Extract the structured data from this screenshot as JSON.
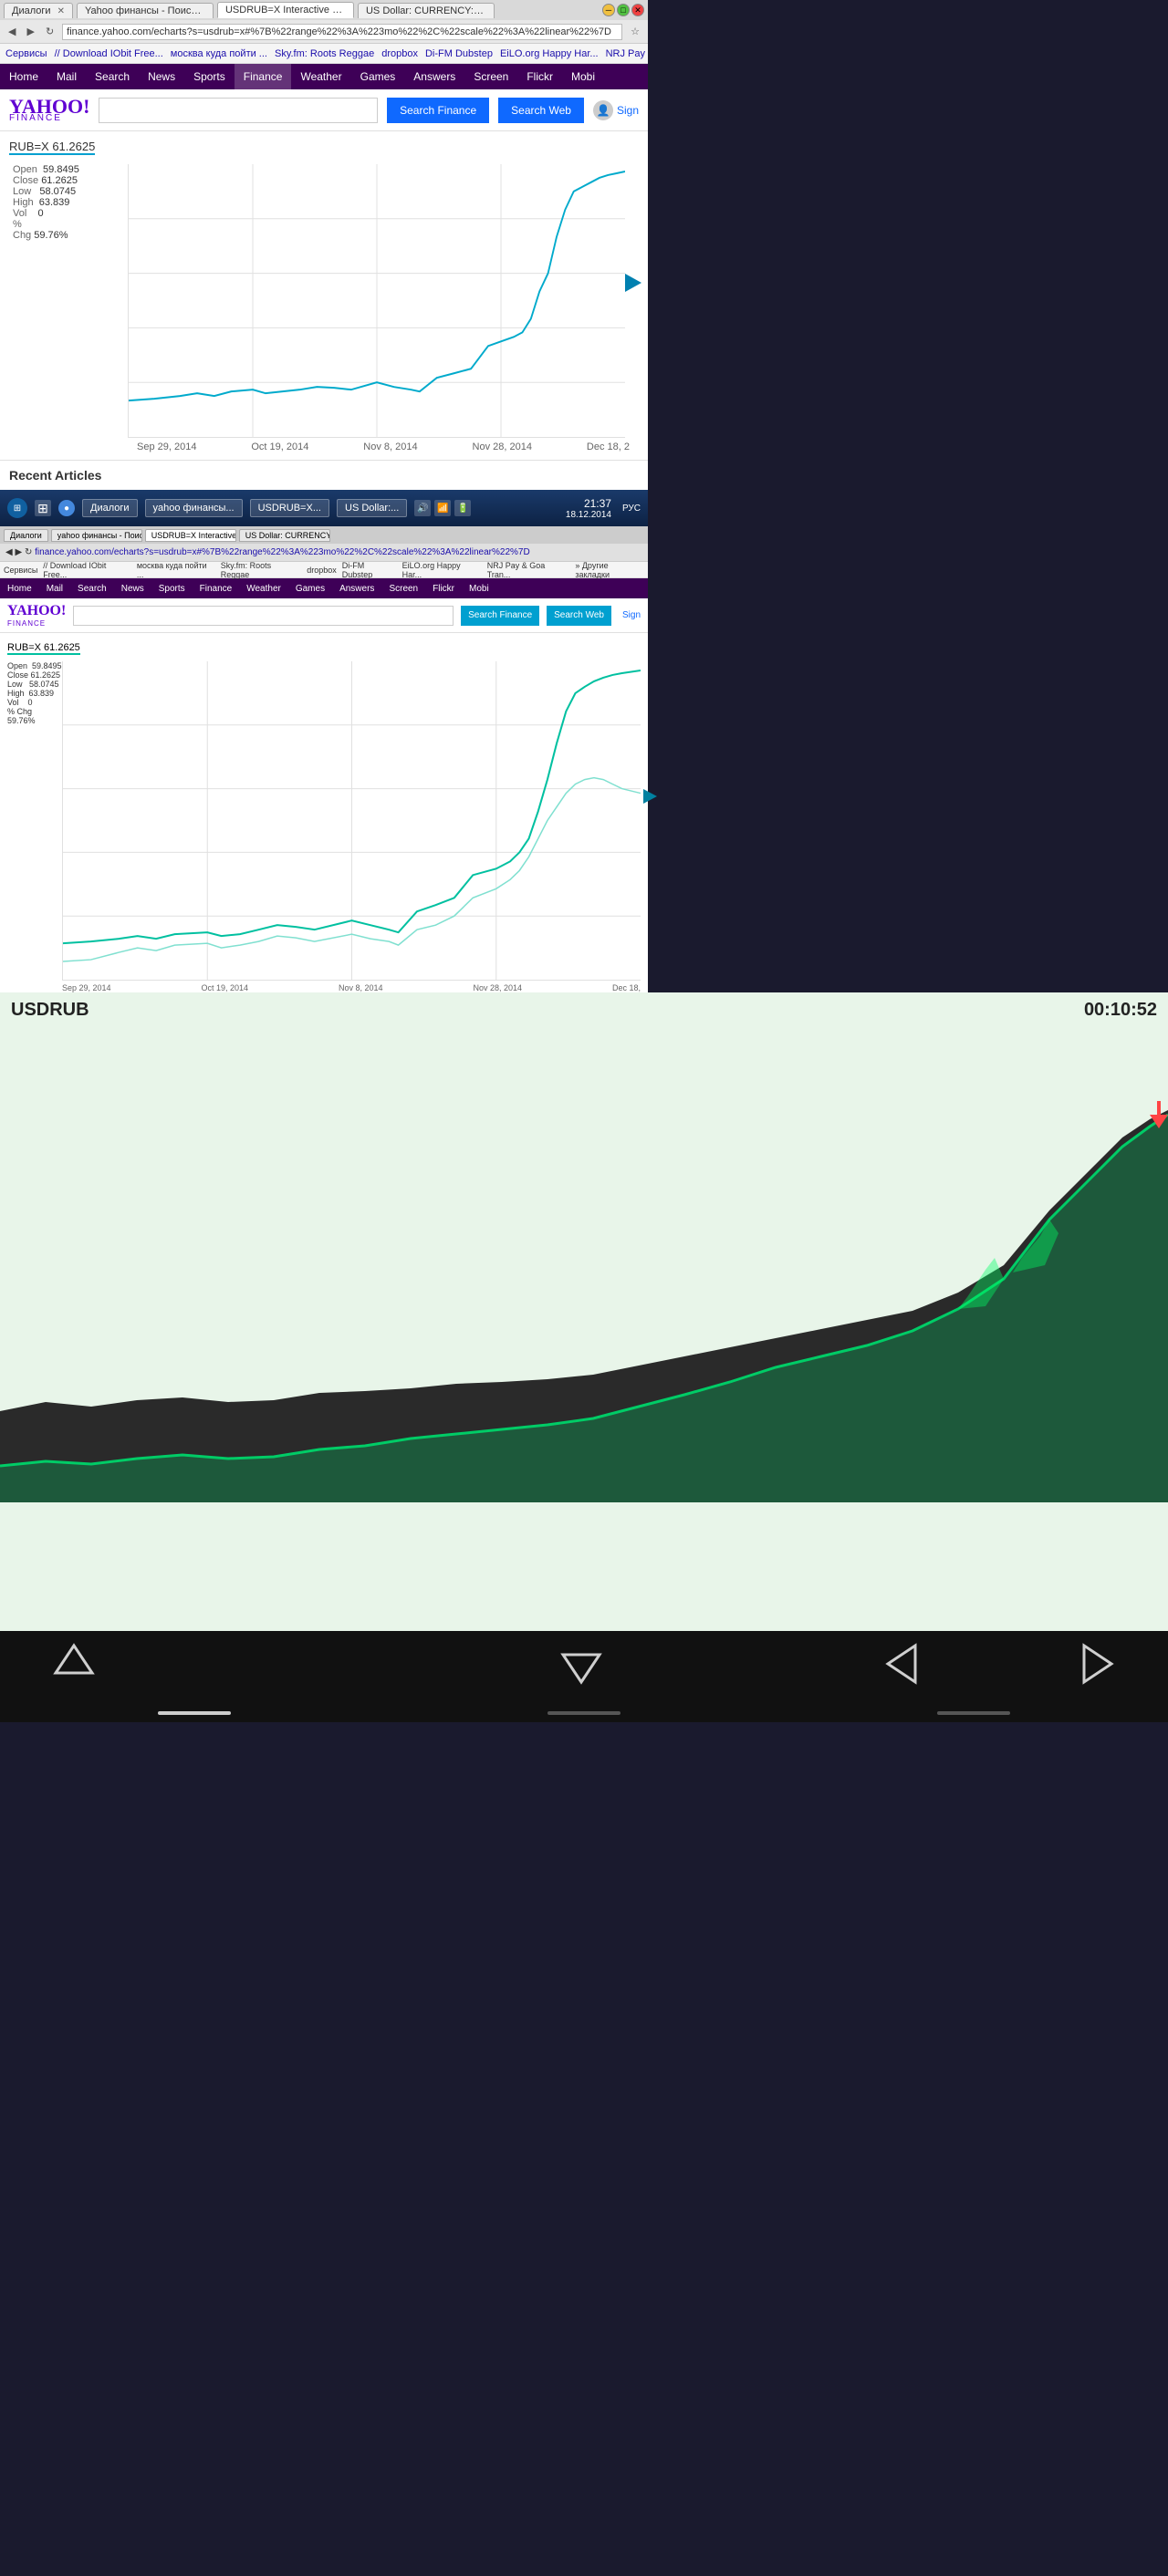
{
  "browser1": {
    "title": "Yahoo финансы - Поиск",
    "tabs": [
      {
        "label": "Диалоги",
        "active": false
      },
      {
        "label": "Yahoo финансы - Поиск",
        "active": false
      },
      {
        "label": "USDRUB=X Interactive St...",
        "active": true
      },
      {
        "label": "US Dollar: CURRENCY:US...",
        "active": false
      }
    ],
    "address": "finance.yahoo.com/echarts?s=usdrub=x#%7B%22range%22%3A%223mo%22%2C%22scale%22%3A%22linear%22%7D",
    "bookmarks": [
      "Сервисы",
      "Download IObit Free...",
      "москва куда пойти ...",
      "Sky.fm: Roots Reggae",
      "dropbox",
      "Di-FM Dubstep",
      "EiLO.org Happy Har...",
      "NRJ Pay & Goa Tran...",
      "Другие закладки"
    ],
    "nav_items": [
      "Home",
      "Mail",
      "Search",
      "News",
      "Sports",
      "Finance",
      "Weather",
      "Games",
      "Answers",
      "Screen",
      "Flickr",
      "Mobi"
    ],
    "logo": "YAHOO!",
    "logo_sub": "FINANCE",
    "search_placeholder": "",
    "btn_search_finance": "Search Finance",
    "btn_search_web": "Search Web",
    "sign_in": "Sign",
    "chart": {
      "tooltip": "RUB=X 61.2625",
      "stats": {
        "open": {
          "label": "Open",
          "value": "59.8495"
        },
        "close": {
          "label": "Close",
          "value": "61.2625"
        },
        "low": {
          "label": "Low",
          "value": "58.0745"
        },
        "high": {
          "label": "High",
          "value": "63.839"
        },
        "vol": {
          "label": "Vol",
          "value": "0"
        },
        "chg": {
          "label": "% Chg",
          "value": "59.76%"
        }
      },
      "dates": [
        "Sep 29, 2014",
        "Oct 19, 2014",
        "Nov 8, 2014",
        "Nov 28, 2014",
        "Dec 18, 2"
      ]
    },
    "recent_articles": "Recent Articles"
  },
  "taskbar": {
    "time": "21:37",
    "date": "18.12.2014",
    "start_items": [
      "Диалоги",
      "yahoo финансы - Поиск",
      "USDRUB=X Interactive...",
      "US Dollar: CURRENCY:US..."
    ]
  },
  "browser2": {
    "tabs": [
      "Диалоги",
      "yahoo финансы - Поиск",
      "USDRUB=X Interactive...",
      "US Dollar: CURRENCY:US..."
    ],
    "address": "finance.yahoo.com/echarts?s=usdrub=x#%7B%22range%22%3A%223mo%22%2C%22scale%22%3A%22linear%22%7D",
    "nav_items": [
      "Home",
      "Mail",
      "Search",
      "News",
      "Sports",
      "Finance",
      "Weather",
      "Games",
      "Answers",
      "Screen",
      "Flickr",
      "Mobi"
    ],
    "btn_search_finance": "Search Finance",
    "btn_search_web": "Search Web",
    "chart_tooltip": "RUB=X 61.2625",
    "dates": [
      "Sep 29, 2014",
      "Oct 19, 2014",
      "Nov 8, 2014",
      "Nov 28, 2014",
      "Dec 18,"
    ]
  },
  "currency_widget": {
    "title": "USDRUB",
    "time": "00:10:52"
  },
  "bottom_nav": {
    "items": [
      "⬆",
      "⬇",
      "⬅",
      "➡"
    ]
  }
}
